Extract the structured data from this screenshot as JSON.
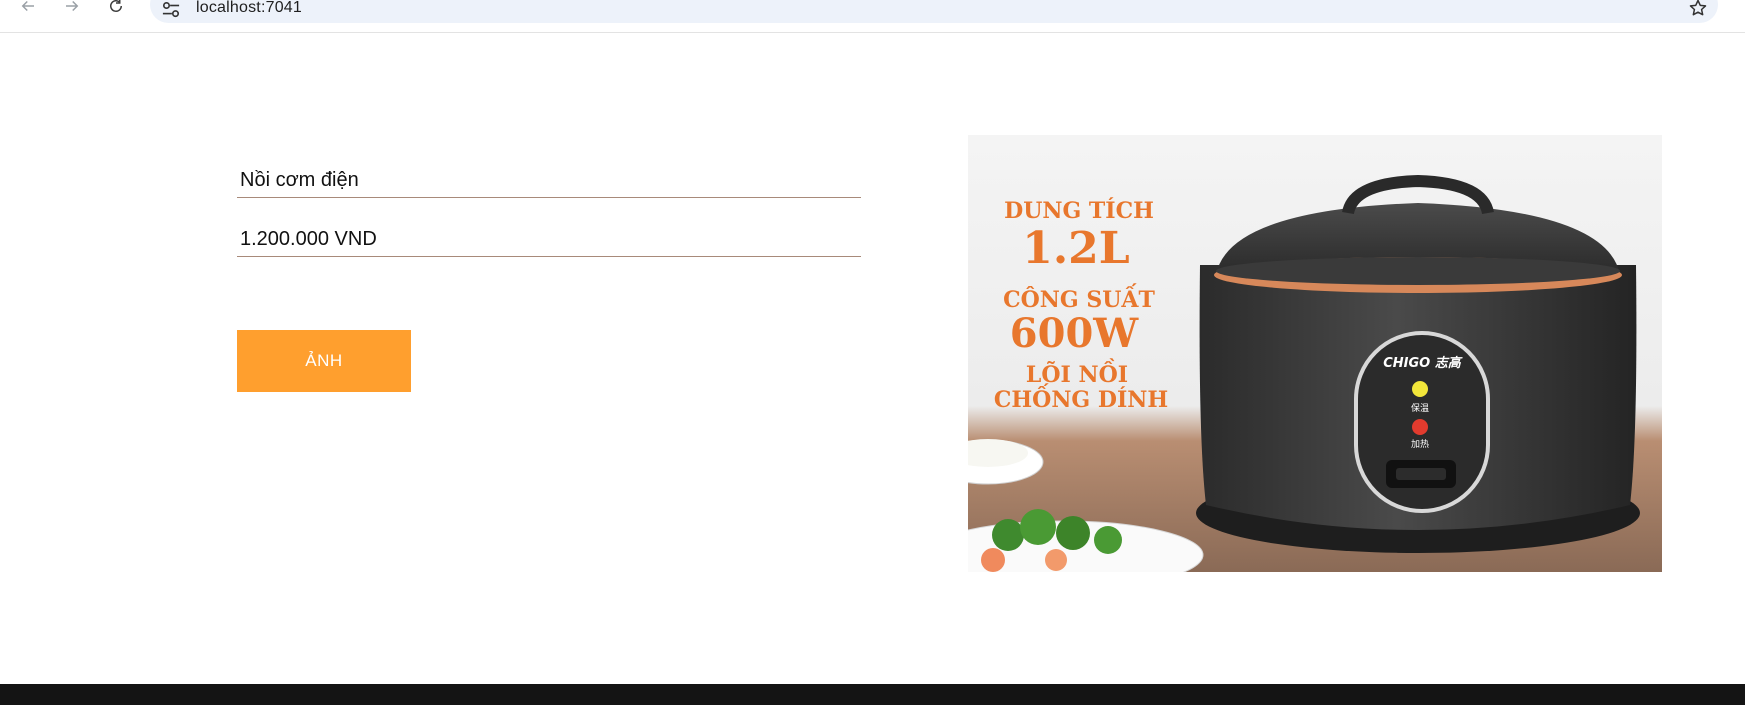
{
  "browser": {
    "url": "localhost:7041",
    "icons": {
      "back": "arrow-left-icon",
      "forward": "arrow-right-icon",
      "reload": "reload-icon",
      "site_info": "tune-icon",
      "bookmark": "star-icon"
    }
  },
  "product": {
    "name": "Nồi cơm điện",
    "price": "1.200.000 VND",
    "image_button_label": "ẢNH",
    "image": {
      "line1": "DUNG TÍCH",
      "line2": "1.2L",
      "line3": "CÔNG SUẤT",
      "line4": "600W",
      "line5": "LÕI NỒI",
      "line6": "CHỐNG DÍNH",
      "brand": "CHIGO 志高",
      "indicator_1": "保温",
      "indicator_2": "加热"
    }
  },
  "colors": {
    "accent_button": "#ff9f2e",
    "field_underline": "#a88a7a",
    "footer": "#141414",
    "image_text": "#e8772d"
  }
}
